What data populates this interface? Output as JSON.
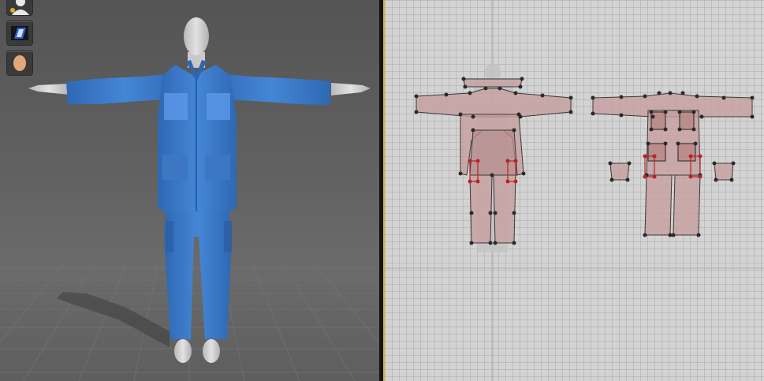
{
  "icons": {
    "avatar_tool": "avatar-silhouette-icon",
    "garment_tool": "garment-book-icon",
    "head_tool": "avatar-head-icon"
  },
  "colors": {
    "garment_blue": "#3e7fd0",
    "pattern_fill": "#c79f9f",
    "accent_divider": "#d8b23a",
    "point": "#2a2a2a",
    "selected_point": "#b52525"
  }
}
